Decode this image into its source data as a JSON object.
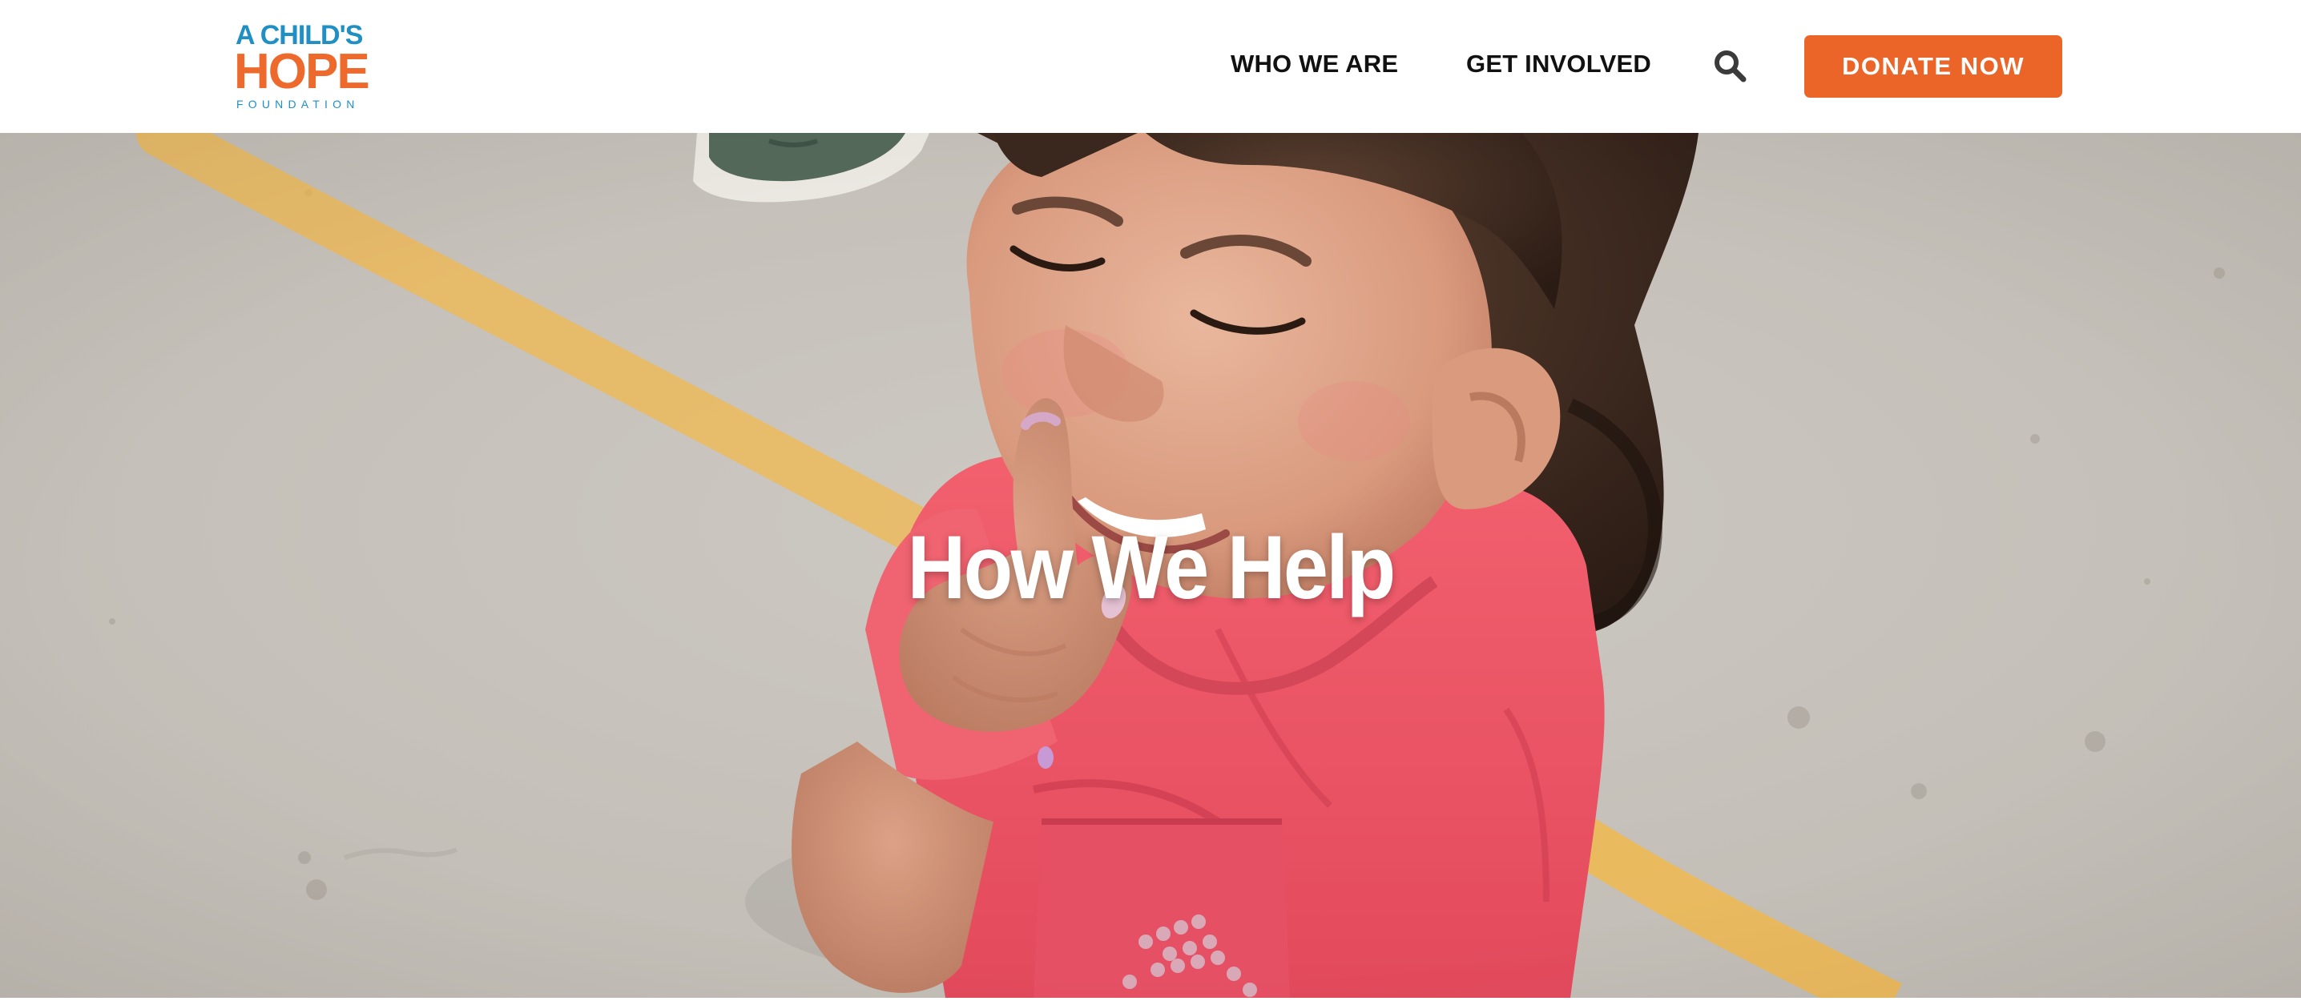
{
  "brand": {
    "line1": "A CHILD'S",
    "line2": "HOPE",
    "line3": "FOUNDATION",
    "blue": "#1f8fc4",
    "orange": "#ee6a2c"
  },
  "nav": {
    "items": [
      {
        "label": "WHO WE ARE"
      },
      {
        "label": "GET INVOLVED"
      }
    ],
    "search_icon": "search-icon",
    "donate_label": "DONATE NOW",
    "donate_color": "#ec6528"
  },
  "hero": {
    "title": "How We Help",
    "image_description_icon": "hero-photo"
  }
}
